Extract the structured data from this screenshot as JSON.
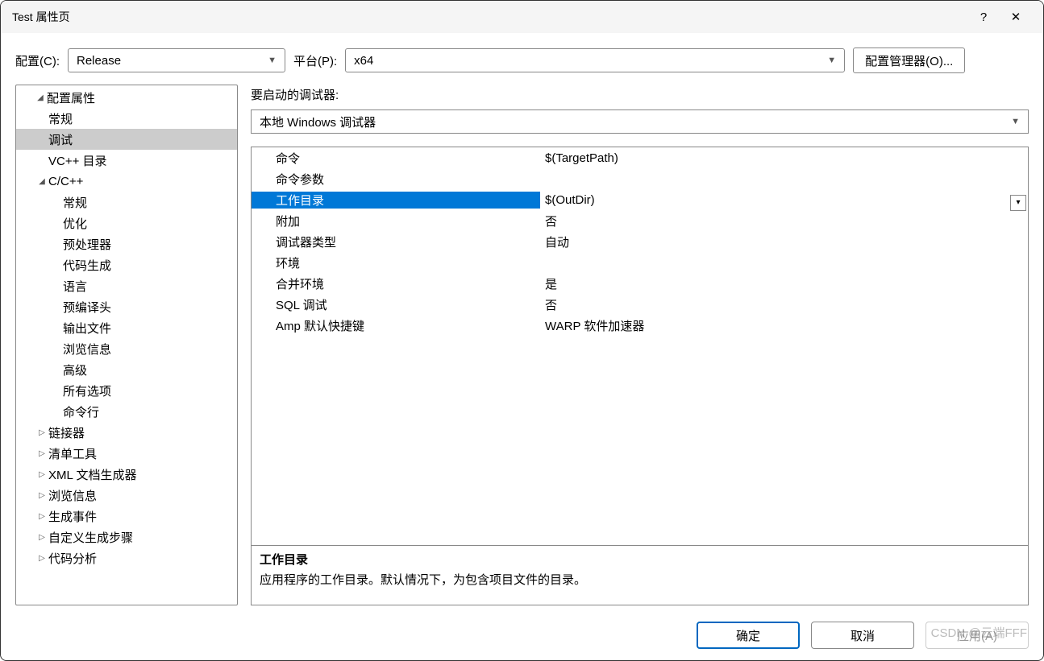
{
  "titlebar": {
    "title": "Test 属性页",
    "help": "?",
    "close": "✕"
  },
  "toolbar": {
    "config_label": "配置(C):",
    "config_value": "Release",
    "platform_label": "平台(P):",
    "platform_value": "x64",
    "cfgmgr_label": "配置管理器(O)..."
  },
  "tree": {
    "root": "配置属性",
    "items": [
      "常规",
      "调试",
      "VC++ 目录"
    ],
    "cpp": "C/C++",
    "cpp_items": [
      "常规",
      "优化",
      "预处理器",
      "代码生成",
      "语言",
      "预编译头",
      "输出文件",
      "浏览信息",
      "高级",
      "所有选项",
      "命令行"
    ],
    "rest": [
      "链接器",
      "清单工具",
      "XML 文档生成器",
      "浏览信息",
      "生成事件",
      "自定义生成步骤",
      "代码分析"
    ]
  },
  "right": {
    "debugger_label": "要启动的调试器:",
    "debugger_value": "本地 Windows 调试器",
    "rows": [
      {
        "name": "命令",
        "value": "$(TargetPath)",
        "selected": false
      },
      {
        "name": "命令参数",
        "value": "",
        "selected": false
      },
      {
        "name": "工作目录",
        "value": "$(OutDir)",
        "selected": true
      },
      {
        "name": "附加",
        "value": "否",
        "selected": false
      },
      {
        "name": "调试器类型",
        "value": "自动",
        "selected": false
      },
      {
        "name": "环境",
        "value": "",
        "selected": false
      },
      {
        "name": "合并环境",
        "value": "是",
        "selected": false
      },
      {
        "name": "SQL 调试",
        "value": "否",
        "selected": false
      },
      {
        "name": "Amp 默认快捷键",
        "value": "WARP 软件加速器",
        "selected": false
      }
    ],
    "desc_title": "工作目录",
    "desc_body": "应用程序的工作目录。默认情况下，为包含项目文件的目录。"
  },
  "footer": {
    "ok": "确定",
    "cancel": "取消",
    "apply": "应用(A)"
  },
  "watermark": "CSDN @云端FFF"
}
